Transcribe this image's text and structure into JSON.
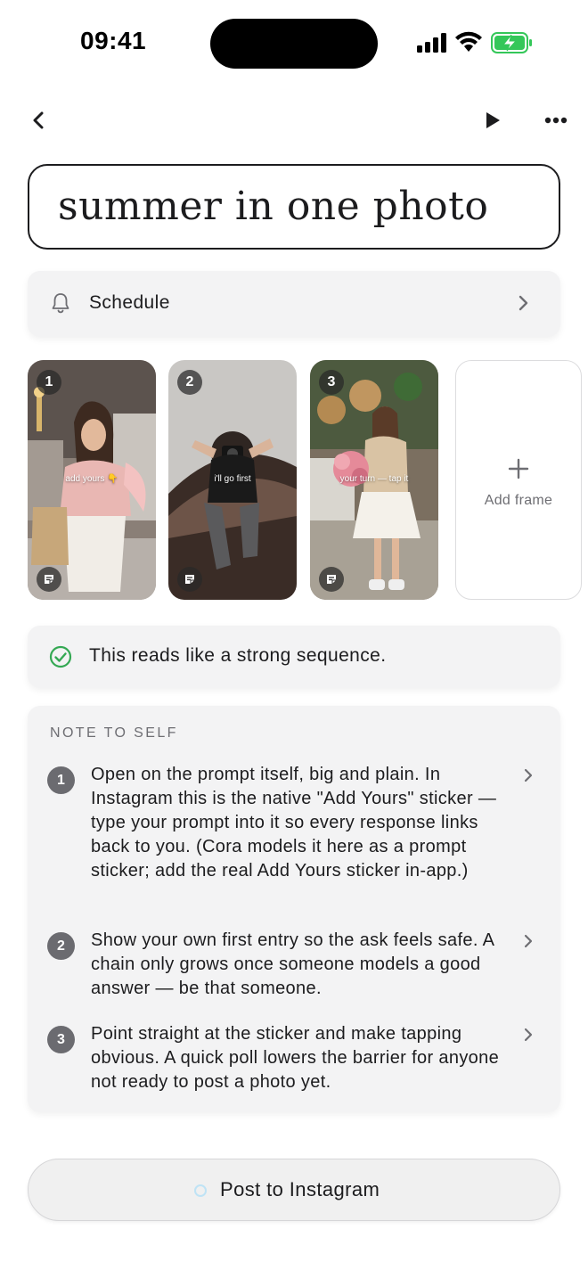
{
  "status_bar": {
    "time": "09:41"
  },
  "title": "summer in one photo",
  "schedule": {
    "label": "Schedule"
  },
  "frames": [
    {
      "number": "1",
      "caption": "add yours 👇"
    },
    {
      "number": "2",
      "caption": "i'll go first"
    },
    {
      "number": "3",
      "caption": "your turn — tap it"
    }
  ],
  "add_frame": {
    "label": "Add frame"
  },
  "feedback": {
    "text": "This reads like a strong sequence.",
    "color": "#34a853"
  },
  "notes": {
    "heading": "NOTE TO SELF",
    "items": [
      {
        "number": "1",
        "text": "Open on the prompt itself, big and plain. In Instagram this is the native \"Add Yours\" sticker — type your prompt into it so every response links back to you. (Cora models it here as a prompt sticker; add the real Add Yours sticker in-app.)"
      },
      {
        "number": "2",
        "text": "Show your own first entry so the ask feels safe. A chain only grows once someone models a good answer — be that someone."
      },
      {
        "number": "3",
        "text": "Point straight at the sticker and make tapping obvious. A quick poll lowers the barrier for anyone not ready to post a photo yet."
      }
    ]
  },
  "post_button": {
    "label": "Post to Instagram"
  },
  "colors": {
    "battery": "#34c759",
    "accent": "#1c1c1e"
  }
}
